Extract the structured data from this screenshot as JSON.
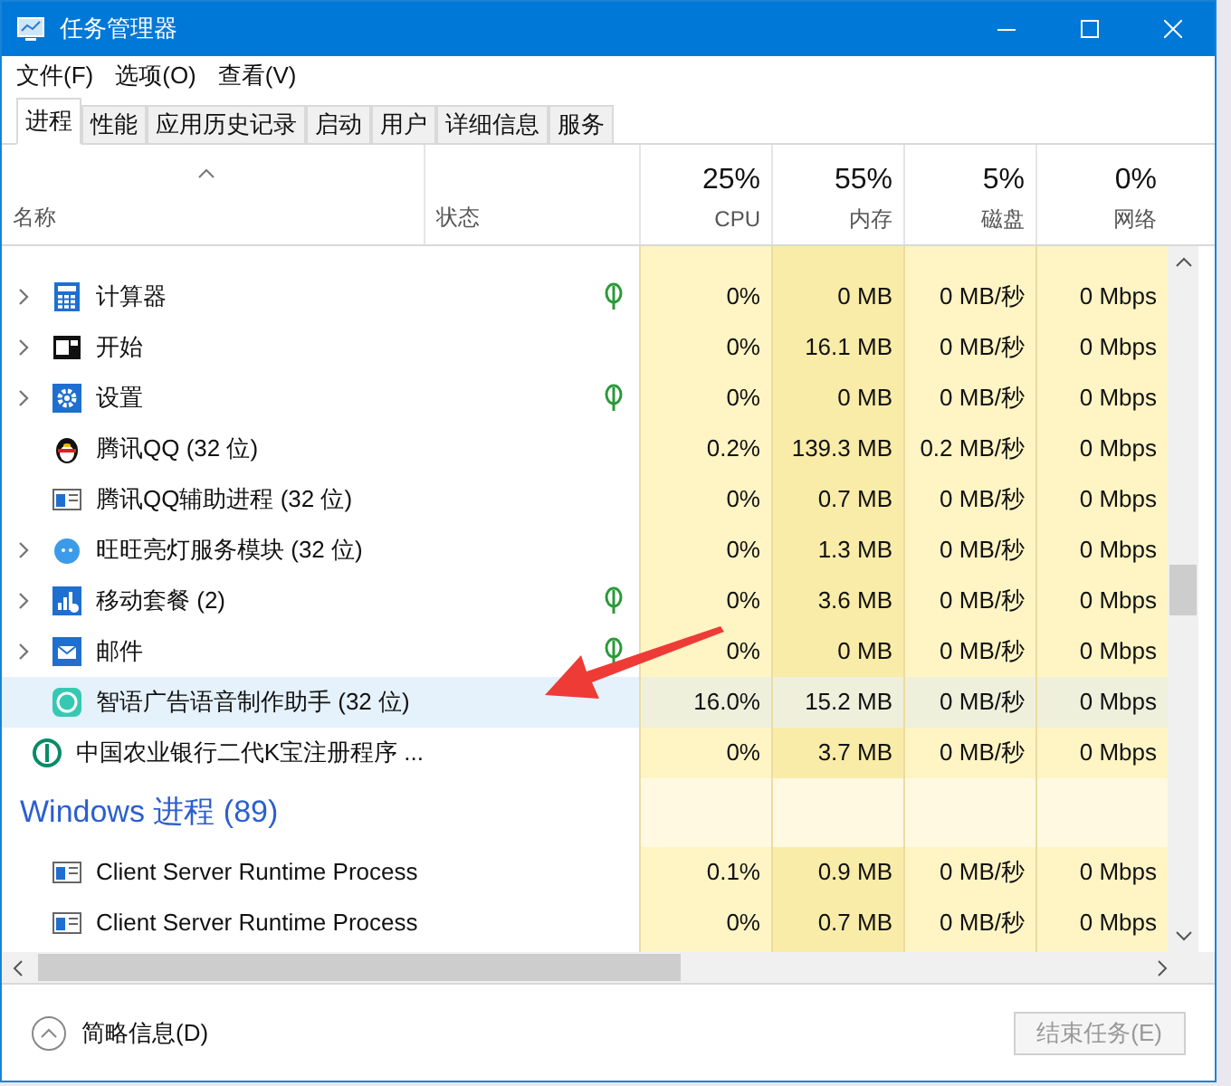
{
  "window": {
    "title": "任务管理器"
  },
  "menu": [
    "文件(F)",
    "选项(O)",
    "查看(V)"
  ],
  "tabs": [
    {
      "label": "进程",
      "selected": true
    },
    {
      "label": "性能",
      "selected": false
    },
    {
      "label": "应用历史记录",
      "selected": false
    },
    {
      "label": "启动",
      "selected": false
    },
    {
      "label": "用户",
      "selected": false
    },
    {
      "label": "详细信息",
      "selected": false
    },
    {
      "label": "服务",
      "selected": false
    }
  ],
  "columns": [
    {
      "label": "名称"
    },
    {
      "label": "状态"
    },
    {
      "label": "CPU",
      "total": "25%"
    },
    {
      "label": "内存",
      "total": "55%"
    },
    {
      "label": "磁盘",
      "total": "5%"
    },
    {
      "label": "网络",
      "total": "0%"
    }
  ],
  "rows": [
    {
      "name": "计算器",
      "expandable": true,
      "suspended": true,
      "selected": false,
      "values": [
        "0%",
        "0 MB",
        "0 MB/秒",
        "0 Mbps"
      ]
    },
    {
      "name": "开始",
      "expandable": true,
      "suspended": false,
      "selected": false,
      "values": [
        "0%",
        "16.1 MB",
        "0 MB/秒",
        "0 Mbps"
      ]
    },
    {
      "name": "设置",
      "expandable": true,
      "suspended": true,
      "selected": false,
      "values": [
        "0%",
        "0 MB",
        "0 MB/秒",
        "0 Mbps"
      ]
    },
    {
      "name": "腾讯QQ (32 位)",
      "expandable": false,
      "suspended": false,
      "selected": false,
      "values": [
        "0.2%",
        "139.3 MB",
        "0.2 MB/秒",
        "0 Mbps"
      ]
    },
    {
      "name": "腾讯QQ辅助进程 (32 位)",
      "expandable": false,
      "suspended": false,
      "selected": false,
      "values": [
        "0%",
        "0.7 MB",
        "0 MB/秒",
        "0 Mbps"
      ]
    },
    {
      "name": "旺旺亮灯服务模块 (32 位)",
      "expandable": true,
      "suspended": false,
      "selected": false,
      "values": [
        "0%",
        "1.3 MB",
        "0 MB/秒",
        "0 Mbps"
      ]
    },
    {
      "name": "移动套餐 (2)",
      "expandable": true,
      "suspended": true,
      "selected": false,
      "values": [
        "0%",
        "3.6 MB",
        "0 MB/秒",
        "0 Mbps"
      ]
    },
    {
      "name": "邮件",
      "expandable": true,
      "suspended": true,
      "selected": false,
      "values": [
        "0%",
        "0 MB",
        "0 MB/秒",
        "0 Mbps"
      ]
    },
    {
      "name": "智语广告语音制作助手 (32 位)",
      "expandable": false,
      "suspended": false,
      "selected": true,
      "values": [
        "16.0%",
        "15.2 MB",
        "0 MB/秒",
        "0 Mbps"
      ]
    },
    {
      "name": "中国农业银行二代K宝注册程序 ...",
      "expandable": false,
      "suspended": false,
      "selected": false,
      "values": [
        "0%",
        "3.7 MB",
        "0 MB/秒",
        "0 Mbps"
      ]
    }
  ],
  "group": {
    "title": "Windows 进程 (89)",
    "rows": [
      {
        "name": "Client Server Runtime Process",
        "expandable": false,
        "suspended": false,
        "selected": false,
        "values": [
          "0.1%",
          "0.9 MB",
          "0 MB/秒",
          "0 Mbps"
        ]
      },
      {
        "name": "Client Server Runtime Process",
        "expandable": false,
        "suspended": false,
        "selected": false,
        "values": [
          "0%",
          "0.7 MB",
          "0 MB/秒",
          "0 Mbps"
        ]
      }
    ]
  },
  "footer": {
    "details_link": "简略信息(D)",
    "end_task_button": "结束任务(E)"
  }
}
